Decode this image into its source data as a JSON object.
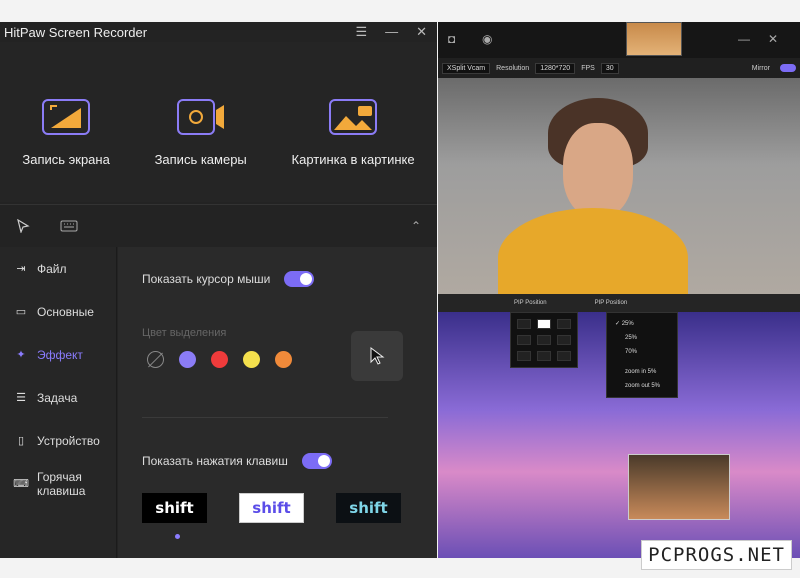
{
  "app": {
    "title": "HitPaw Screen Recorder",
    "window_controls": [
      "☰",
      "—",
      "✕"
    ]
  },
  "modes": [
    {
      "label": "Запись экрана",
      "icon": "screen-record-icon"
    },
    {
      "label": "Запись камеры",
      "icon": "camera-record-icon"
    },
    {
      "label": "Картинка в картинке",
      "icon": "picture-in-picture-icon"
    }
  ],
  "tools": {
    "cursor_icon": "cursor-icon",
    "keyboard_icon": "keyboard-icon",
    "collapse": "⌃"
  },
  "sidebar": {
    "items": [
      {
        "label": "Файл",
        "icon": "file-export-icon"
      },
      {
        "label": "Основные",
        "icon": "video-icon"
      },
      {
        "label": "Эффект",
        "icon": "sparkle-icon",
        "active": true
      },
      {
        "label": "Задача",
        "icon": "sliders-icon"
      },
      {
        "label": "Устройство",
        "icon": "device-icon"
      },
      {
        "label": "Горячая клавиша",
        "line1": "Горячая",
        "line2": "клавиша",
        "icon": "hotkey-icon"
      }
    ]
  },
  "effect": {
    "show_cursor_label": "Показать курсор мыши",
    "show_cursor_enabled": true,
    "highlight_label": "Цвет выделения",
    "colors": [
      "none",
      "#8b7cf6",
      "#ef3b3b",
      "#f4e04d",
      "#f08a3a"
    ],
    "show_keys_label": "Показать нажатия клавиш",
    "show_keys_enabled": true,
    "key_styles": [
      "shift",
      "shift",
      "shift"
    ]
  },
  "right": {
    "camera_select": "XSplit Vcam",
    "resolution_label": "Resolution",
    "resolution_value": "1280*720",
    "fps_label": "FPS",
    "fps_value": "30",
    "mirror_label": "Mirror",
    "pip_label_1": "PIP Position",
    "pip_label_2": "PIP Position",
    "size_options": [
      "25%",
      "25%",
      "70%"
    ],
    "size_checked": "✓",
    "zoom_in": "zoom in 5%",
    "zoom_out": "zoom out 5%"
  },
  "watermark": "PCPROGS.NET",
  "colors": {
    "accent": "#7c6cf5",
    "panel": "#232323"
  }
}
